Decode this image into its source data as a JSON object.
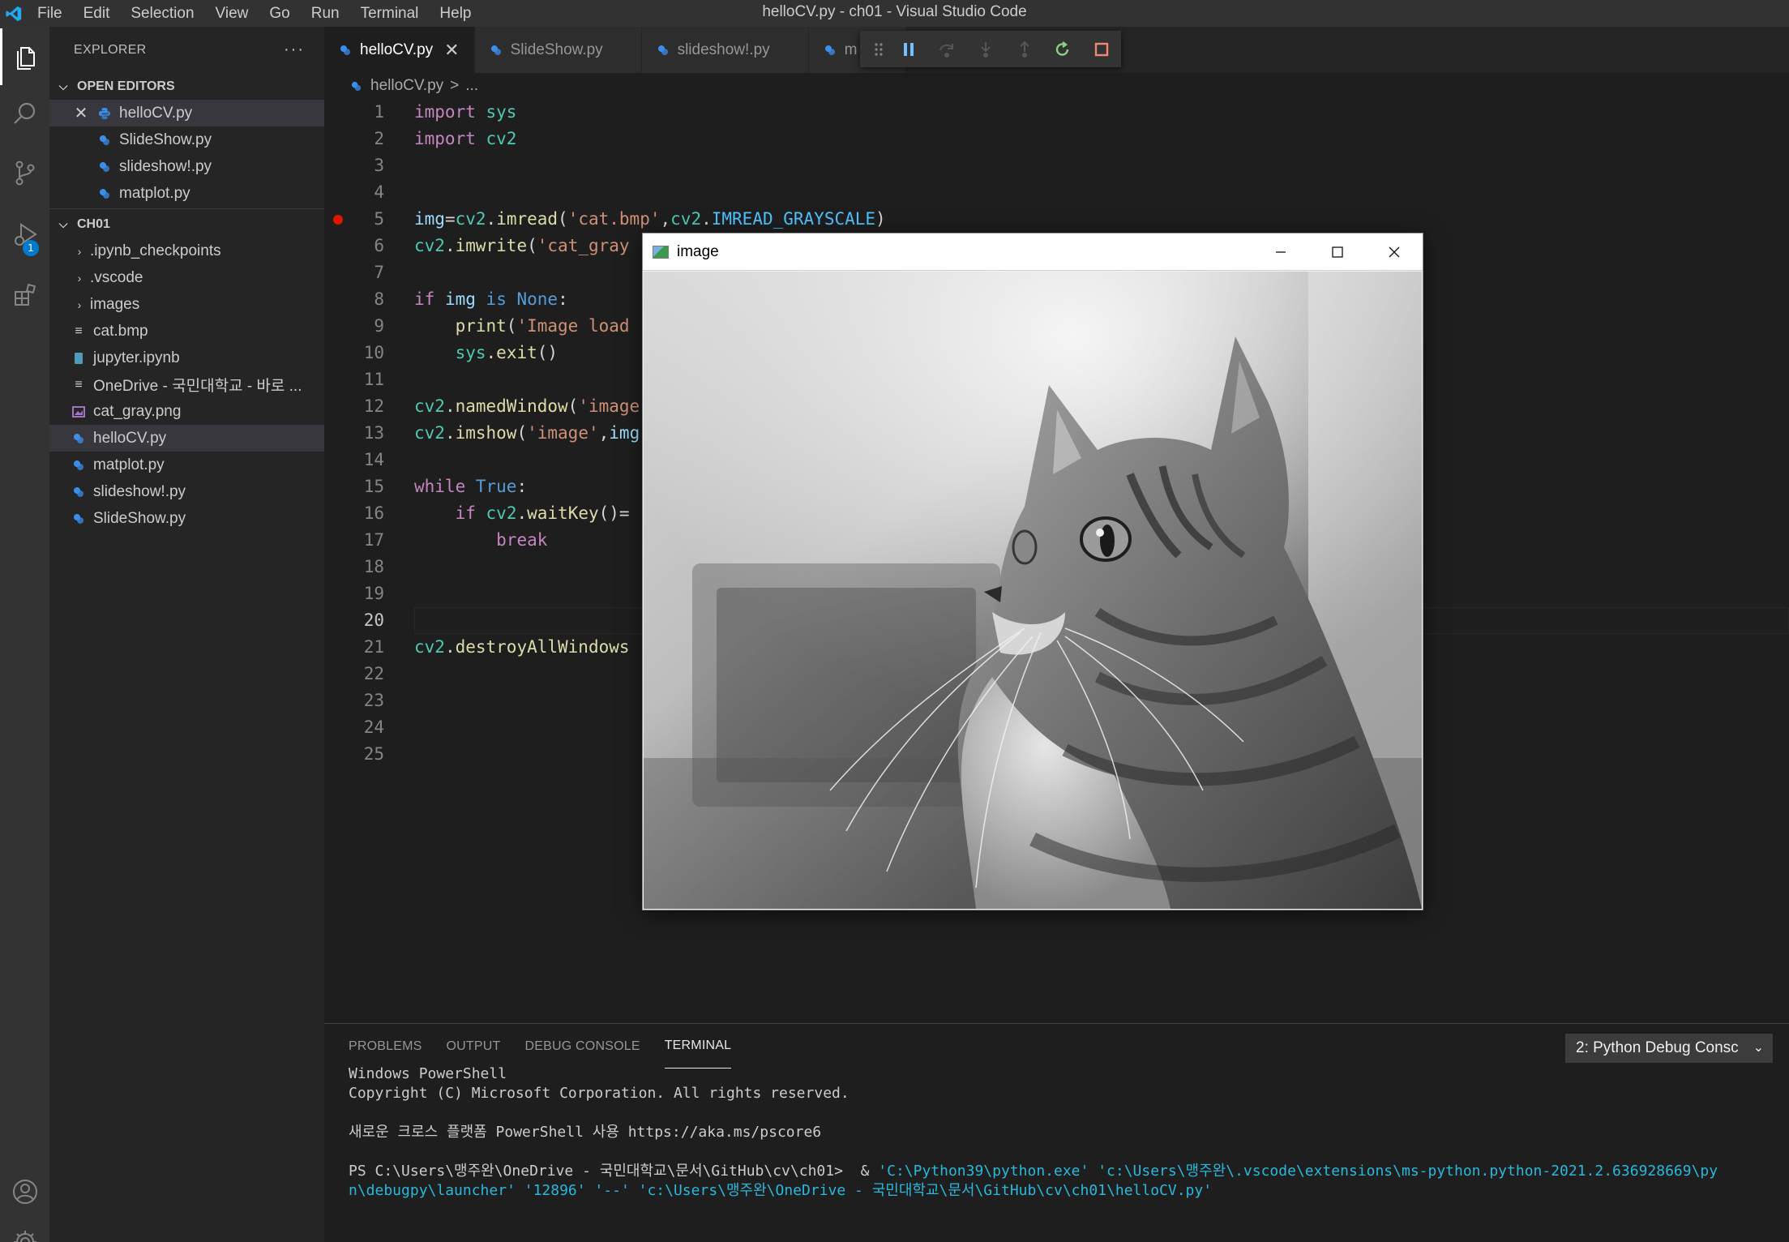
{
  "window": {
    "title": "helloCV.py - ch01 - Visual Studio Code"
  },
  "menu": [
    "File",
    "Edit",
    "Selection",
    "View",
    "Go",
    "Run",
    "Terminal",
    "Help"
  ],
  "activity": {
    "debug_badge": "1"
  },
  "sidebar": {
    "title": "EXPLORER",
    "more": "···",
    "open_editors": {
      "label": "OPEN EDITORS",
      "items": [
        "helloCV.py",
        "SlideShow.py",
        "slideshow!.py",
        "matplot.py"
      ]
    },
    "folder": {
      "label": "CH01",
      "items": [
        {
          "name": ".ipynb_checkpoints",
          "type": "folder"
        },
        {
          "name": ".vscode",
          "type": "folder"
        },
        {
          "name": "images",
          "type": "folder"
        },
        {
          "name": "cat.bmp",
          "type": "file"
        },
        {
          "name": "jupyter.ipynb",
          "type": "notebook"
        },
        {
          "name": "OneDrive - 국민대학교 - 바로 ...",
          "type": "file"
        },
        {
          "name": "cat_gray.png",
          "type": "image"
        },
        {
          "name": "helloCV.py",
          "type": "python"
        },
        {
          "name": "matplot.py",
          "type": "python"
        },
        {
          "name": "slideshow!.py",
          "type": "python"
        },
        {
          "name": "SlideShow.py",
          "type": "python"
        }
      ]
    }
  },
  "tabs": [
    "helloCV.py",
    "SlideShow.py",
    "slideshow!.py",
    "m"
  ],
  "breadcrumb": {
    "file": "helloCV.py",
    "sep": ">",
    "rest": "..."
  },
  "editor": {
    "line_numbers": [
      "1",
      "2",
      "3",
      "4",
      "5",
      "6",
      "7",
      "8",
      "9",
      "10",
      "11",
      "12",
      "13",
      "14",
      "15",
      "16",
      "17",
      "18",
      "19",
      "20",
      "21",
      "22",
      "23",
      "24",
      "25"
    ],
    "current_line": "20",
    "breakpoint_line": "5"
  },
  "image_window": {
    "title": "image"
  },
  "panel": {
    "tabs": [
      "PROBLEMS",
      "OUTPUT",
      "DEBUG CONSOLE",
      "TERMINAL"
    ],
    "terminal_select": "2: Python Debug Consc",
    "terminal": {
      "l1": "Windows PowerShell",
      "l2": "Copyright (C) Microsoft Corporation. All rights reserved.",
      "l3": "새로운 크로스 플랫폼 PowerShell 사용 https://aka.ms/pscore6",
      "prompt": "PS C:\\Users\\맹주완\\OneDrive - 국민대학교\\문서\\GitHub\\cv\\ch01>  & ",
      "cmd1": "'C:\\Python39\\python.exe' 'c:\\Users\\맹주완\\.vscode\\extensions\\ms-python.python-2021.2.636928669\\py",
      "cmd2": "n\\debugpy\\launcher' '12896' '--' 'c:\\Users\\맹주완\\OneDrive - 국민대학교\\문서\\GitHub\\cv\\ch01\\helloCV.py'"
    }
  }
}
